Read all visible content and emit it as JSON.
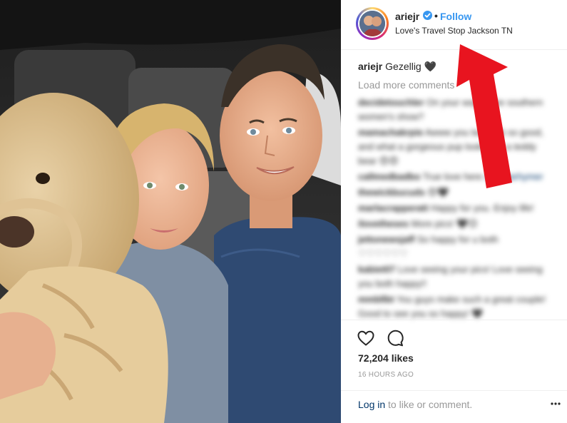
{
  "post": {
    "username": "ariejr",
    "follow_label": "Follow",
    "separator": "•",
    "location": "Love's Travel Stop Jackson TN",
    "caption_user": "ariejr",
    "caption_text": " Gezellig 🖤",
    "load_more_label": "Load more comments",
    "comments": [
      {
        "user": "decidetouchler",
        "text": "On your way to the southern women's show?"
      },
      {
        "user": "mamachakrpie",
        "text": "Awww you two look so good, and what a gorgeous pup looks like a teddy bear 😍😍"
      },
      {
        "user": "callmedbadbo",
        "text": "True love here",
        "tag": "@guitarhymer"
      },
      {
        "user": "thewickbucuds",
        "text": "😍🖤"
      },
      {
        "user": "marlacrapperatt",
        "text": "Happy for you. Enjoy life!"
      },
      {
        "user": "ilovetheses",
        "text": "More pics! 🖤😊"
      },
      {
        "user": "jettonewsjaff",
        "text": "So happy for u both ♡♡♡♡♡♡"
      },
      {
        "user": "kabiet07",
        "text": "Love seeing your pics! Love seeing you both happy!!"
      },
      {
        "user": "mmbllbt",
        "text": "You guys make such a great couple! Good to see you so happy! 🖤"
      }
    ],
    "likes": "72,204 likes",
    "timestamp": "16 HOURS AGO",
    "login_link": "Log in",
    "login_suffix": " to like or comment.",
    "more_options": "•••"
  },
  "icons": {
    "verified": "verified-badge-icon",
    "like": "heart-icon",
    "comment": "comment-bubble-icon",
    "more": "more-options-icon"
  },
  "colors": {
    "accent_blue": "#3897f0",
    "link_dark": "#003569",
    "muted_gray": "#999999",
    "annotation_red": "#e8141f"
  }
}
